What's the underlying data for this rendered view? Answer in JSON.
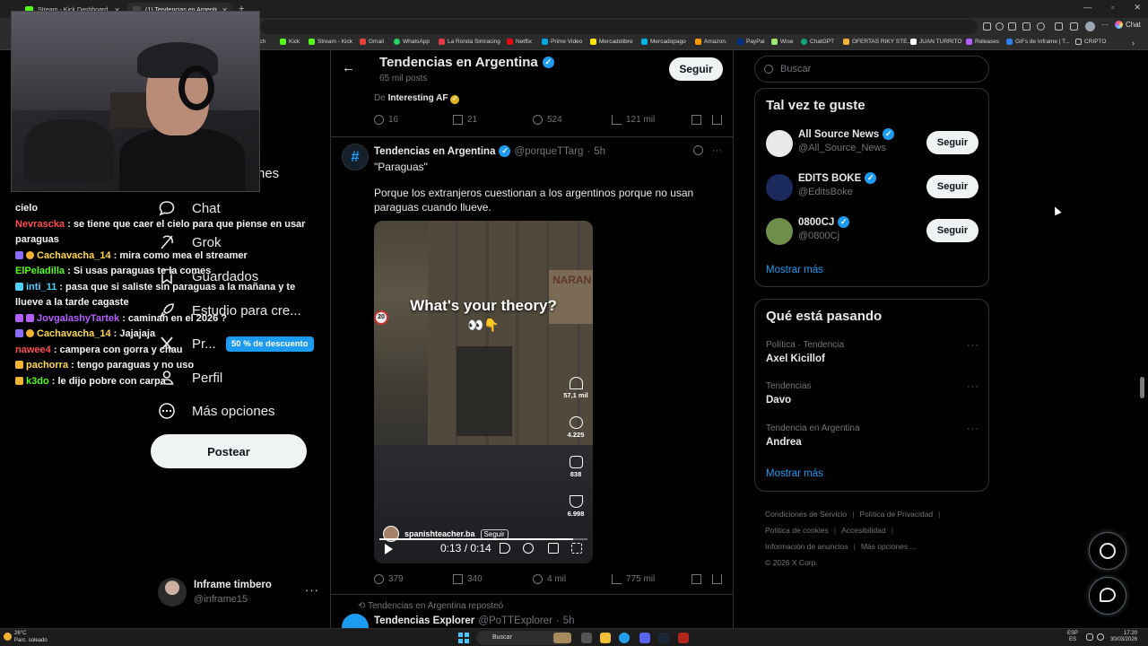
{
  "browser": {
    "tabs": [
      {
        "title": "Stream - Kick Dashboard",
        "active": false,
        "color": "#53fc18"
      },
      {
        "title": "(1) Tendencias en Argentina (@po...",
        "active": true,
        "color": "#000000"
      }
    ],
    "bookmarks": [
      {
        "label": "itch",
        "color": "#9146ff"
      },
      {
        "label": "Kick",
        "color": "#53fc18"
      },
      {
        "label": "Stream - Kick",
        "color": "#53fc18"
      },
      {
        "label": "Gmail",
        "color": "#ea4335"
      },
      {
        "label": "WhatsApp",
        "color": "#25d366"
      },
      {
        "label": "La Ronda Simracing",
        "color": "#e63946"
      },
      {
        "label": "Netflix",
        "color": "#e50914"
      },
      {
        "label": "Prime Video",
        "color": "#00a8e1"
      },
      {
        "label": "Mercadolibre",
        "color": "#ffe600"
      },
      {
        "label": "Mercadopago",
        "color": "#00b1ea"
      },
      {
        "label": "Amazon.",
        "color": "#ff9900"
      },
      {
        "label": "PayPal",
        "color": "#003087"
      },
      {
        "label": "Wise",
        "color": "#9fe870"
      },
      {
        "label": "ChatGPT",
        "color": "#10a37f"
      },
      {
        "label": "OFERTAS RIKY STE...",
        "color": "#f2b233"
      },
      {
        "label": "JUAN TURRITO",
        "color": "#ffffff"
      },
      {
        "label": "Releases",
        "color": "#b45fff"
      },
      {
        "label": "GIFs de Inframe | T...",
        "color": "#2f80ed"
      },
      {
        "label": "CRIPTO",
        "color": "#c8c8c8"
      }
    ],
    "chat_button": "Chat"
  },
  "overlay_chat": [
    {
      "user": "",
      "text": "cielo",
      "color": "#f4f4f4",
      "badge": ""
    },
    {
      "user": "Nevrascka",
      "text": ": se tiene que caer el cielo para que piense en usar paraguas",
      "color": "#ff4d4d",
      "badge": ""
    },
    {
      "user": "Cachavacha_14",
      "text": ": mira como mea el streamer",
      "color": "#ffd84d",
      "badge": "#8a6dff"
    },
    {
      "user": "ElPeladilla",
      "text": ": Si usas paraguas te la comes",
      "color": "#53fc18",
      "badge": ""
    },
    {
      "user": "inti_11",
      "text": ": pasa que si saliste sin paraguas a la mañana y te llueve a la tarde cagaste",
      "color": "#4dd2ff",
      "badge": "#4dd2ff"
    },
    {
      "user": "JovgalashyTartek",
      "text": ": caminan en el 2026 ?",
      "color": "#b45fff",
      "badge": "#b45fff"
    },
    {
      "user": "Cachavacha_14",
      "text": ": Jajajaja",
      "color": "#ffd84d",
      "badge": "#8a6dff"
    },
    {
      "user": "nawee4",
      "text": ": campera con gorra y chau",
      "color": "#ff4d4d",
      "badge": ""
    },
    {
      "user": "pachorra",
      "text": ": tengo paraguas y no uso",
      "color": "#ffd84d",
      "badge": "#f2b233"
    },
    {
      "user": "k3do",
      "text": ": le dijo pobre con carpa",
      "color": "#53fc18",
      "badge": "#f2b233"
    }
  ],
  "nav": {
    "partial_label": "nes",
    "items": [
      {
        "label": "Chat",
        "icon": "chat-icon"
      },
      {
        "label": "Grok",
        "icon": "grok-icon"
      },
      {
        "label": "Guardados",
        "icon": "bookmark-icon"
      },
      {
        "label": "Estudio para cre...",
        "icon": "rocket-icon"
      },
      {
        "label": "Pr...",
        "icon": "x-premium-icon"
      },
      {
        "label": "Perfil",
        "icon": "profile-icon"
      },
      {
        "label": "Más opciones",
        "icon": "more-icon"
      }
    ],
    "premium_badge": "50 % de descuento",
    "post_button": "Postear",
    "account": {
      "name": "Inframe timbero",
      "handle": "@inframe15"
    }
  },
  "main": {
    "title": "Tendencias en Argentina",
    "post_count": "65 mil posts",
    "follow_label": "Seguir",
    "prev_tweet": {
      "source_prefix": "De",
      "source_name": "Interesting AF",
      "stats": {
        "replies": "16",
        "reposts": "21",
        "likes": "524",
        "views": "121 mil"
      }
    },
    "tweet": {
      "author": "Tendencias en Argentina",
      "handle": "@porqueTTarg",
      "time": "5h",
      "quote": "\"Paraguas\"",
      "text": "Porque los extranjeros cuestionan a los argentinos porque no usan paraguas cuando llueve.",
      "video": {
        "caption": "What's your theory?",
        "emoji": "👀👇",
        "speed_sign": "20",
        "sign_text": "NARAN",
        "likes": "57,1 mil",
        "comments": "4.225",
        "shares": "838",
        "sends": "6.998",
        "creator": "spanishteacher.ba",
        "creator_follow": "Seguir",
        "time": "0:13 / 0:14",
        "progress": 0.93
      },
      "stats": {
        "replies": "379",
        "reposts": "340",
        "likes": "4 mil",
        "views": "775 mil"
      }
    },
    "reposted_by": "Tendencias en Argentina reposteó",
    "next_tweet": {
      "author": "Tendencias Explorer",
      "handle": "@PoTTExplorer",
      "time": "5h"
    }
  },
  "sidebar": {
    "search_placeholder": "Buscar",
    "suggestions_title": "Tal vez te guste",
    "suggestions": [
      {
        "name": "All Source News",
        "handle": "@All_Source_News",
        "follow": "Seguir",
        "avatar_color": "#e9e9e9"
      },
      {
        "name": "EDITS BOKE",
        "handle": "@EditsBoke",
        "follow": "Seguir",
        "avatar_color": "#1a2a5c"
      },
      {
        "name": "0800CJ",
        "handle": "@0800Cj",
        "follow": "Seguir",
        "avatar_color": "#6e8f4a"
      }
    ],
    "show_more": "Mostrar más",
    "trends_title": "Qué está pasando",
    "trends": [
      {
        "context": "Política · Tendencia",
        "name": "Axel Kicillof"
      },
      {
        "context": "Tendencias",
        "name": "Davo"
      },
      {
        "context": "Tendencia en Argentina",
        "name": "Andrea"
      }
    ],
    "trends_show_more": "Mostrar más",
    "footer": [
      "Condiciones de Servicio",
      "Política de Privacidad",
      "Política de cookies",
      "Accesibilidad",
      "Información de anuncios",
      "Más opciones ...",
      "© 2026 X Corp."
    ]
  },
  "taskbar": {
    "weather_temp": "26°C",
    "weather_desc": "Parc. soleado",
    "search": "Buscar",
    "lang_top": "ESP",
    "lang_bottom": "ES",
    "time": "17:20",
    "date": "30/03/2026"
  }
}
